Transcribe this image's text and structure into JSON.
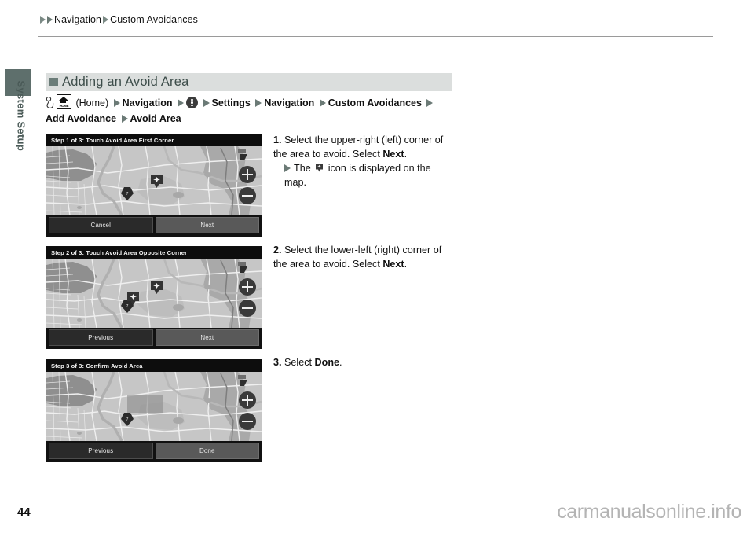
{
  "breadcrumb": {
    "arrow_icon": "triangle-right-icon",
    "items": [
      "Navigation",
      "Custom Avoidances"
    ]
  },
  "sidebar": {
    "tab_label": "System Setup",
    "tab_color": "#5e6f6c"
  },
  "section": {
    "bullet_icon": "square-bullet-icon",
    "title": "Adding an Avoid Area",
    "header_bg": "#dbdedd",
    "title_color": "#3d4d4a"
  },
  "nav_path": {
    "hand_icon": "hand-press-icon",
    "home_icon": "home-button-icon",
    "home_icon_label": "HOME",
    "home_paren": "(Home)",
    "menu_icon": "three-dots-icon",
    "arrow_icon": "triangle-right-icon",
    "segments": [
      "Navigation",
      "Settings",
      "Navigation",
      "Custom Avoidances",
      "Add Avoidance",
      "Avoid Area"
    ]
  },
  "steps": [
    {
      "number": "1.",
      "text_before": "Select the upper-right (left) corner of the area to avoid. Select ",
      "bold_word": "Next",
      "text_after": ".",
      "sub_arrow_icon": "triangle-right-icon",
      "sub_before": "The ",
      "sub_icon": "avoid-area-pin-icon",
      "sub_after": " icon is displayed on the map."
    },
    {
      "number": "2.",
      "text_before": "Select the lower-left (right) corner of the area to avoid. Select ",
      "bold_word": "Next",
      "text_after": "."
    },
    {
      "number": "3.",
      "text_before": "Select ",
      "bold_word": "Done",
      "text_after": "."
    }
  ],
  "screens": [
    {
      "title": "Step 1 of 3: Touch Avoid Area First Corner",
      "zoom_in_icon": "zoom-in-icon",
      "zoom_out_icon": "zoom-out-icon",
      "pins": 1,
      "selection_rect": false,
      "buttons": [
        {
          "label": "Cancel",
          "style": "dark"
        },
        {
          "label": "Next",
          "style": "light"
        }
      ]
    },
    {
      "title": "Step 2 of 3: Touch Avoid Area Opposite Corner",
      "zoom_in_icon": "zoom-in-icon",
      "zoom_out_icon": "zoom-out-icon",
      "pins": 2,
      "selection_rect": false,
      "buttons": [
        {
          "label": "Previous",
          "style": "dark"
        },
        {
          "label": "Next",
          "style": "light"
        }
      ]
    },
    {
      "title": "Step 3 of 3: Confirm Avoid Area",
      "zoom_in_icon": "zoom-in-icon",
      "zoom_out_icon": "zoom-out-icon",
      "pins": 0,
      "selection_rect": true,
      "buttons": [
        {
          "label": "Previous",
          "style": "dark"
        },
        {
          "label": "Done",
          "style": "light"
        }
      ]
    }
  ],
  "footer": {
    "page_number": "44",
    "watermark": "carmanualsonline.info"
  }
}
